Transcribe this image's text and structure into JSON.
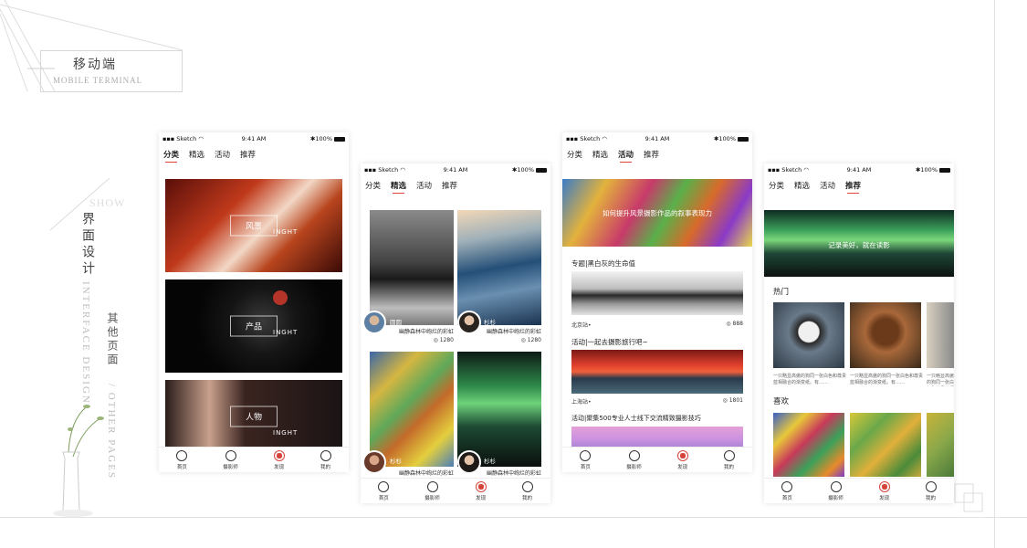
{
  "page": {
    "title_cn": "移动端",
    "title_en": "MOBILE TERMINAL",
    "show": "SHOW",
    "vertical_title": "界面设计",
    "vertical_en": "INTERFACE DESIGN",
    "vertical_sub": "其他页面",
    "vertical_sub_en": "/ OTHER PAGES"
  },
  "status": {
    "carrier": "Sketch",
    "time": "9:41 AM",
    "battery": "100%"
  },
  "tabs": [
    "分类",
    "精选",
    "活动",
    "推荐"
  ],
  "nav": [
    "首页",
    "摄影师",
    "发现",
    "我的"
  ],
  "phone1": {
    "categories": [
      {
        "label": "风景",
        "en": "INGHT"
      },
      {
        "label": "产品",
        "en": "INGHT"
      },
      {
        "label": "人物",
        "en": "INGHT"
      }
    ]
  },
  "phone2": {
    "cards": [
      {
        "user": "圆圆",
        "caption": "幽静森林中绚烂的彩虹",
        "count": "1280"
      },
      {
        "user": "杉杉",
        "caption": "幽静森林中绚烂的彩虹",
        "count": "1280"
      },
      {
        "user": "杉杉",
        "caption": "幽静森林中绚烂的彩虹",
        "count": ""
      },
      {
        "user": "杉杉",
        "caption": "幽静森林中绚烂的彩虹",
        "count": ""
      }
    ]
  },
  "phone3": {
    "banner": "如何提升风景摄影作品的叙事表现力",
    "items": [
      {
        "title": "专题|黑白灰的生命值",
        "location": "北京站•",
        "count": "888"
      },
      {
        "title": "活动|一起去摄影旅行吧~",
        "location": "上海站•",
        "count": "1801"
      },
      {
        "title": "活动|聚集500专业人士线下交流精致摄影技巧",
        "location": "",
        "count": ""
      }
    ]
  },
  "phone4": {
    "banner": "记录美好，就在读影",
    "hot_title": "热门",
    "hot_caption": "一只略显高傲的狗同一张白色和尊贵蓝相融合的渐变纸。有……",
    "like_title": "喜欢"
  },
  "colors": {
    "accent": "#e0443a"
  }
}
